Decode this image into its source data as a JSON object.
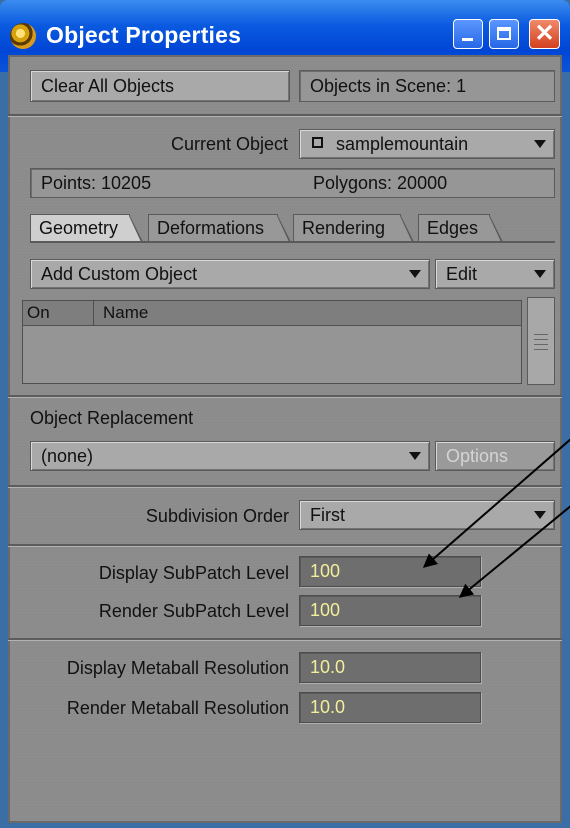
{
  "window": {
    "title": "Object Properties"
  },
  "top": {
    "clear_button": "Clear All Objects",
    "objects_in_scene": "Objects in Scene: 1"
  },
  "current_object": {
    "label": "Current Object",
    "value": "samplemountain",
    "points": "Points: 10205",
    "polygons": "Polygons: 20000"
  },
  "tabs": [
    "Geometry",
    "Deformations",
    "Rendering",
    "Edges"
  ],
  "geometry": {
    "add_custom_object": "Add Custom Object",
    "edit": "Edit",
    "list_columns": [
      "On",
      "Name"
    ]
  },
  "object_replacement": {
    "label": "Object Replacement",
    "value": "(none)",
    "options_button": "Options"
  },
  "subdivision": {
    "label": "Subdivision Order",
    "value": "First"
  },
  "subpatch": {
    "display_label": "Display SubPatch Level",
    "display_value": "100",
    "render_label": "Render SubPatch Level",
    "render_value": "100"
  },
  "metaball": {
    "display_label": "Display Metaball Resolution",
    "display_value": "10.0",
    "render_label": "Render Metaball Resolution",
    "render_value": "10.0"
  }
}
